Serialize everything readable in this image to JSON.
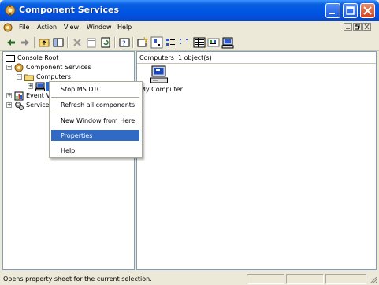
{
  "window": {
    "title": "Component Services"
  },
  "menubar": {
    "items": [
      "File",
      "Action",
      "View",
      "Window",
      "Help"
    ]
  },
  "tree": {
    "root": "Console Root",
    "component_services": "Component Services",
    "computers": "Computers",
    "event_viewer": "Event V",
    "services": "Services"
  },
  "right_pane": {
    "header_label": "Computers",
    "header_count": "1 object(s)",
    "item_label": "My Computer"
  },
  "context_menu": {
    "items": [
      "Stop MS DTC",
      "Refresh all components",
      "New Window from Here",
      "Properties",
      "Help"
    ],
    "highlighted": "Properties"
  },
  "status": {
    "text": "Opens property sheet for the current selection."
  },
  "colors": {
    "title_bar": "#0054e3",
    "highlight": "#316ac5"
  }
}
